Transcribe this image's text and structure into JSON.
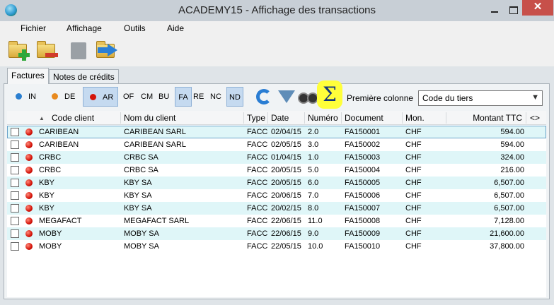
{
  "window": {
    "title": "ACADEMY15 - Affichage des transactions",
    "close_label": "✕"
  },
  "menu": [
    "Fichier",
    "Affichage",
    "Outils",
    "Aide"
  ],
  "toolbar": [
    "new-folder-icon",
    "delete-folder-icon",
    "disabled-document-icon",
    "export-arrow-icon"
  ],
  "tabs": [
    {
      "label": "Factures",
      "active": true
    },
    {
      "label": "Notes de crédits",
      "active": false
    }
  ],
  "filters": {
    "status": [
      {
        "label": "IN",
        "color": "#2a7fd0",
        "active": false
      },
      {
        "label": "DE",
        "color": "#e88a1e",
        "active": false
      },
      {
        "label": "AR",
        "color": "#d4140a",
        "active": true
      }
    ],
    "types": [
      {
        "label": "OF",
        "active": false
      },
      {
        "label": "CM",
        "active": false
      },
      {
        "label": "BU",
        "active": false
      },
      {
        "label": "FA",
        "active": true
      },
      {
        "label": "RE",
        "active": false
      },
      {
        "label": "NC",
        "active": false
      },
      {
        "label": "ND",
        "active": true
      }
    ],
    "first_column_label": "Première colonne",
    "first_column_value": "Code du tiers",
    "sigma_label": "Σ"
  },
  "table": {
    "headers": {
      "client_code": "Code client",
      "client_name": "Nom du client",
      "type": "Type",
      "date": "Date",
      "number": "Numéro",
      "document": "Document",
      "currency": "Mon.",
      "amount": "Montant TTC",
      "expand": "<>"
    },
    "rows": [
      {
        "code": "CARIBEAN",
        "name": "CARIBEAN SARL",
        "type": "FACC",
        "date": "02/04/15",
        "number": "2.0",
        "document": "FA150001",
        "currency": "CHF",
        "amount": "594.00"
      },
      {
        "code": "CARIBEAN",
        "name": "CARIBEAN SARL",
        "type": "FACC",
        "date": "02/05/15",
        "number": "3.0",
        "document": "FA150002",
        "currency": "CHF",
        "amount": "594.00"
      },
      {
        "code": "CRBC",
        "name": "CRBC SA",
        "type": "FACC",
        "date": "01/04/15",
        "number": "1.0",
        "document": "FA150003",
        "currency": "CHF",
        "amount": "324.00"
      },
      {
        "code": "CRBC",
        "name": "CRBC SA",
        "type": "FACC",
        "date": "20/05/15",
        "number": "5.0",
        "document": "FA150004",
        "currency": "CHF",
        "amount": "216.00"
      },
      {
        "code": "KBY",
        "name": "KBY SA",
        "type": "FACC",
        "date": "20/05/15",
        "number": "6.0",
        "document": "FA150005",
        "currency": "CHF",
        "amount": "6,507.00"
      },
      {
        "code": "KBY",
        "name": "KBY SA",
        "type": "FACC",
        "date": "20/06/15",
        "number": "7.0",
        "document": "FA150006",
        "currency": "CHF",
        "amount": "6,507.00"
      },
      {
        "code": "KBY",
        "name": "KBY SA",
        "type": "FACC",
        "date": "20/02/15",
        "number": "8.0",
        "document": "FA150007",
        "currency": "CHF",
        "amount": "6,507.00"
      },
      {
        "code": "MEGAFACT",
        "name": "MEGAFACT SARL",
        "type": "FACC",
        "date": "22/06/15",
        "number": "11.0",
        "document": "FA150008",
        "currency": "CHF",
        "amount": "7,128.00"
      },
      {
        "code": "MOBY",
        "name": "MOBY SA",
        "type": "FACC",
        "date": "22/06/15",
        "number": "9.0",
        "document": "FA150009",
        "currency": "CHF",
        "amount": "21,600.00"
      },
      {
        "code": "MOBY",
        "name": "MOBY SA",
        "type": "FACC",
        "date": "22/05/15",
        "number": "10.0",
        "document": "FA150010",
        "currency": "CHF",
        "amount": "37,800.00"
      }
    ]
  }
}
